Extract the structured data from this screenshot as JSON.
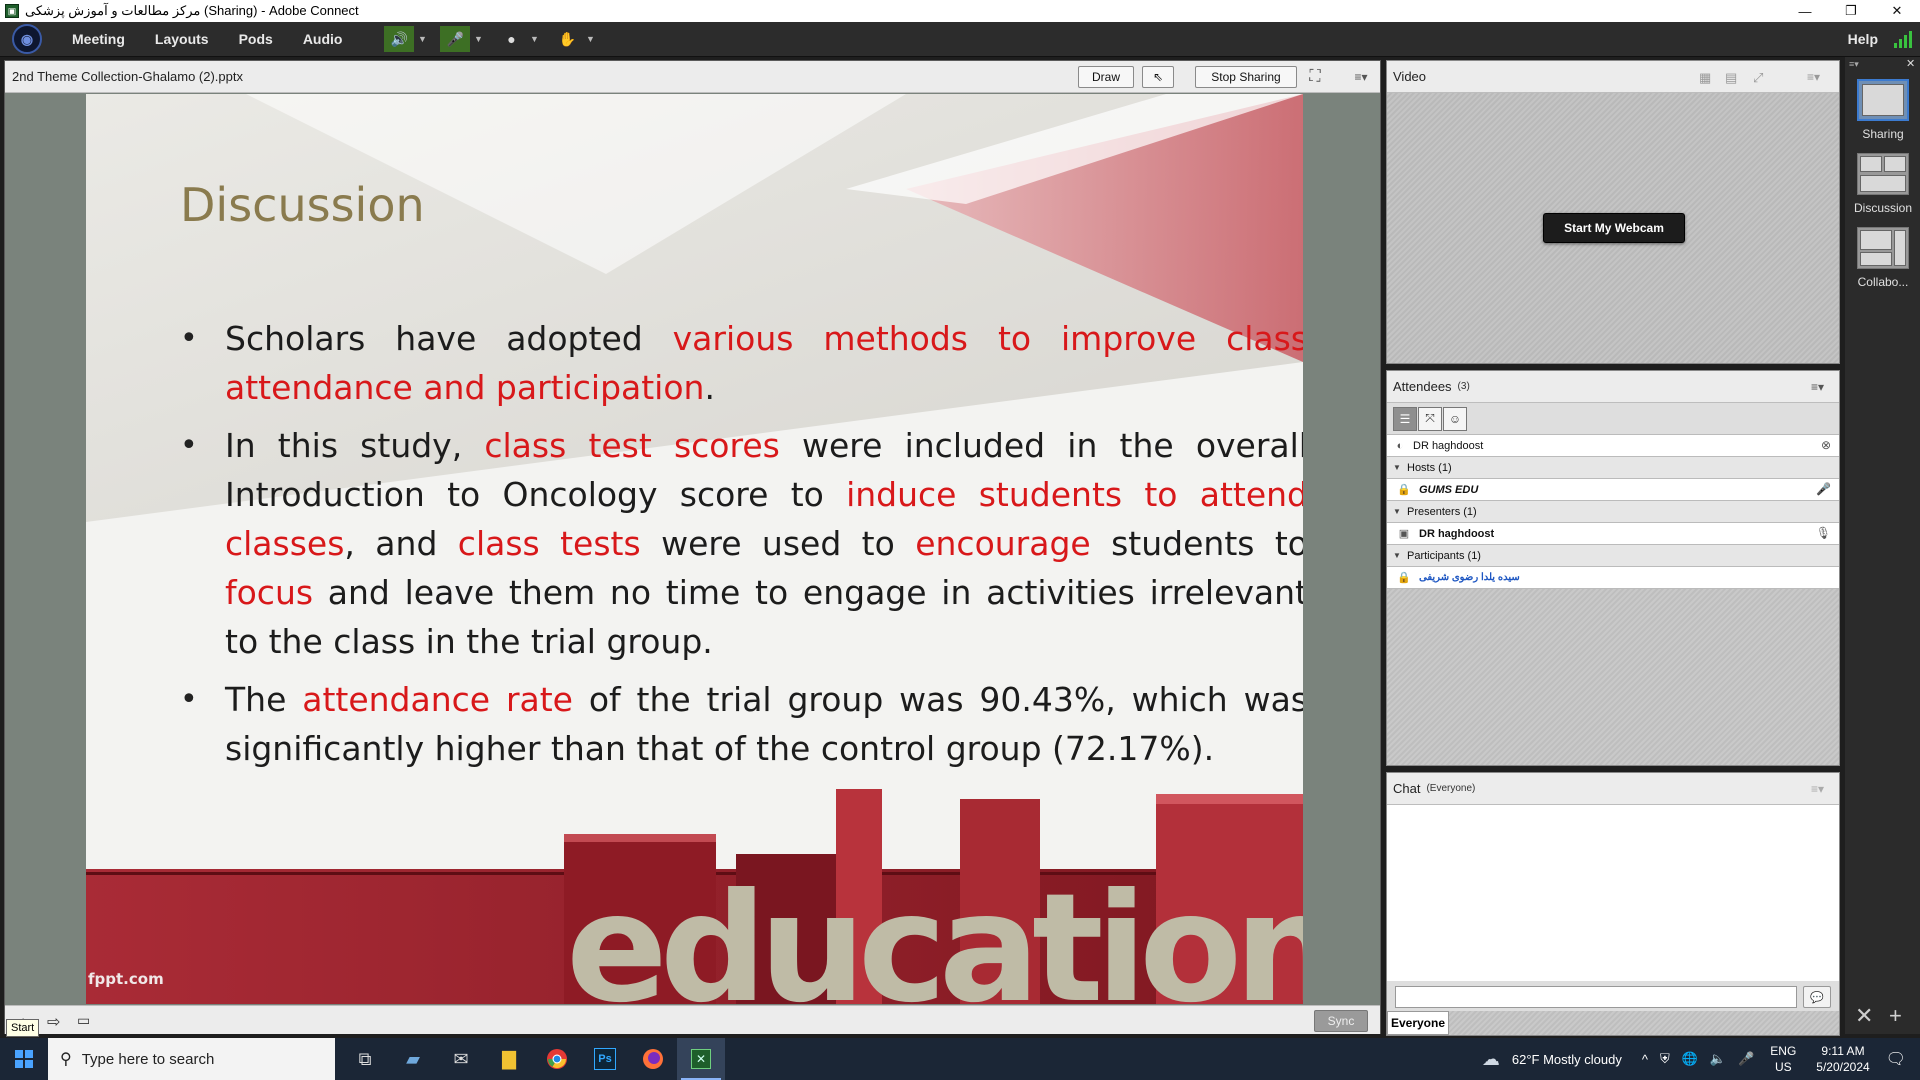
{
  "window": {
    "title": "مرکز مطالعات و آموزش پزشکی (Sharing) - Adobe Connect"
  },
  "menu": {
    "items": [
      "Meeting",
      "Layouts",
      "Pods",
      "Audio"
    ],
    "help": "Help"
  },
  "share_pod": {
    "title": "2nd Theme Collection-Ghalamo (2).pptx",
    "draw_label": "Draw",
    "stop_sharing_label": "Stop Sharing",
    "sync_label": "Sync",
    "tooltip": "Start"
  },
  "slide": {
    "heading": "Discussion",
    "bullet1": {
      "p1": "Scholars have adopted ",
      "h1": "various methods to improve class attendance and participation",
      "p2": "."
    },
    "bullet2": {
      "p1": "In this study, ",
      "h1": "class test scores",
      "p2": " were included in the overall Introduction to Oncology score to ",
      "h2": "induce students to attend classes",
      "p3": ", and ",
      "h3": "class tests",
      "p4": " were used to ",
      "h4": "encourage",
      "p5": " students to ",
      "h5": "focus",
      "p6": " and leave them no time to engage in activities irrelevant to the class in the trial group."
    },
    "bullet3": {
      "p1": "The ",
      "h1": "attendance rate",
      "p2": " of the trial group was 90.43%, which was significantly higher than that of the control group (72.17%)."
    },
    "footer_word": "education",
    "watermark": "fppt.com"
  },
  "video_pod": {
    "title": "Video",
    "webcam_button": "Start My Webcam"
  },
  "attendees_pod": {
    "title": "Attendees",
    "count": "(3)",
    "speaker": "DR haghdoost",
    "groups": [
      {
        "label": "Hosts (1)",
        "members": [
          "GUMS EDU"
        ]
      },
      {
        "label": "Presenters (1)",
        "members": [
          "DR haghdoost"
        ]
      },
      {
        "label": "Participants (1)",
        "members": [
          "سیده یلدا رضوی شریفی"
        ]
      }
    ]
  },
  "chat_pod": {
    "title": "Chat",
    "scope": "(Everyone)",
    "tab": "Everyone"
  },
  "layouts_bar": {
    "items": [
      "Sharing",
      "Discussion",
      "Collabo..."
    ]
  },
  "taskbar": {
    "search_placeholder": "Type here to search",
    "weather": "62°F  Mostly cloudy",
    "lang": "ENG",
    "region": "US",
    "time": "9:11 AM",
    "date": "5/20/2024"
  },
  "colors": {
    "highlight": "#d8181a",
    "heading": "#8a7b4e",
    "menubar": "#2c2c2c",
    "taskbar": "#1b2636"
  }
}
